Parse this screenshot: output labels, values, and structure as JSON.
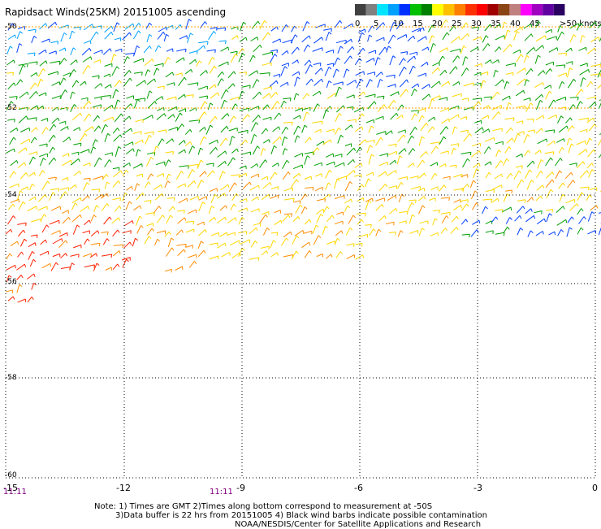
{
  "title": "Rapidsact Winds(25KM) 20151005 ascending",
  "colorbar": {
    "labels": [
      "0",
      "5",
      "10",
      "15",
      "20",
      "25",
      "30",
      "35",
      "40",
      "45",
      ">50 knots"
    ],
    "colors": [
      "#404040",
      "#808080",
      "#00e5ff",
      "#00a0ff",
      "#0030ff",
      "#00c000",
      "#008000",
      "#ffff00",
      "#ffc000",
      "#ff8000",
      "#ff3000",
      "#ff0000",
      "#a00000",
      "#8b4513",
      "#c08080",
      "#ff00ff",
      "#a000c0",
      "#6000a0",
      "#2a0060"
    ]
  },
  "map": {
    "lat_labels": [
      "-50",
      "-52",
      "-54",
      "-56",
      "-58",
      "-60"
    ],
    "lon_labels": [
      "-15",
      "-12",
      "-9",
      "-6",
      "-3",
      "0"
    ],
    "time_labels": [
      "11:11",
      "11:11"
    ],
    "grid_color": "#000000",
    "contour_color": "#ffa500",
    "wind_colors": {
      "blue": "#0040ff",
      "lightblue": "#00a0ff",
      "green": "#00a000",
      "yellow": "#ffd700",
      "orange": "#ff8c00",
      "red": "#ff2000"
    }
  },
  "notes": [
    "Note: 1) Times are GMT 2)Times along bottom correspond to measurement at -50S",
    "3)Data buffer is 22 hrs from 20151005 4) Black wind barbs indicate possible contamination",
    "NOAA/NESDIS/Center for Satellite Applications and Research"
  ]
}
